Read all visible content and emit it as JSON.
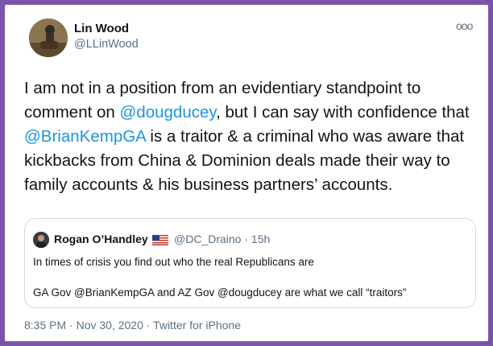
{
  "tweet": {
    "name": "Lin Wood",
    "handle": "@LLinWood",
    "more_icon": "ooo",
    "text_1": "I am not in a position from an evidentiary standpoint to comment on ",
    "mention_1": "@dougducey",
    "text_2": ", but I can say with confidence that ",
    "mention_2": "@BrianKempGA",
    "text_3": " is a traitor & a criminal who was aware that kickbacks from China & Dominion deals made their way to family accounts & his business partners’ accounts.",
    "timestamp": "8:35 PM · Nov 30, 2020 · Twitter for iPhone"
  },
  "quote": {
    "name": "Rogan O’Handley",
    "handle_time": "@DC_Draino · 15h",
    "line1": "In times of crisis you find out who the real Republicans are",
    "line2": "GA Gov @BrianKempGA and AZ Gov @dougducey are what we call “traitors”"
  },
  "colors": {
    "frame": "#7b54a8",
    "link": "#1b95e0",
    "muted": "#5b7083",
    "text": "#0f1419"
  },
  "icons": [
    "avatar-photo",
    "more-options-icon",
    "us-flag-icon"
  ]
}
